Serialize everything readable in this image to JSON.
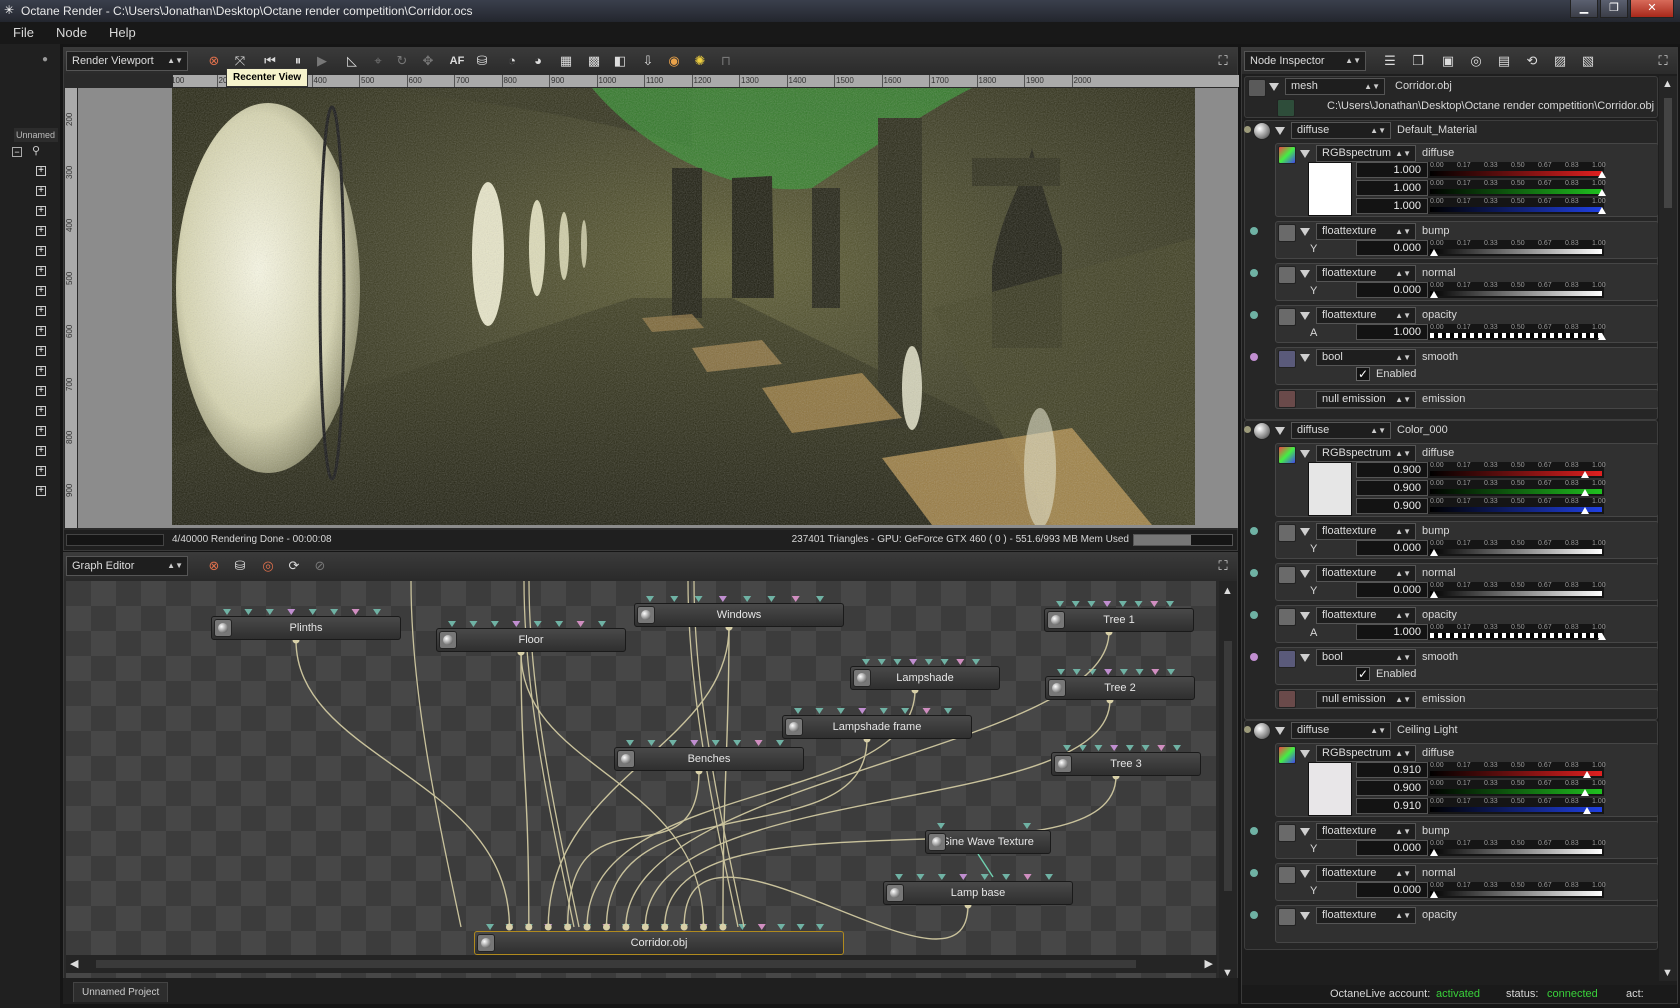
{
  "window": {
    "title": "Octane Render - C:\\Users\\Jonathan\\Desktop\\Octane render competition\\Corridor.ocs"
  },
  "menu": [
    "File",
    "Node",
    "Help"
  ],
  "left_panel": {
    "tab_label": "Unnamed Pr"
  },
  "render_viewport": {
    "panel_label": "Render Viewport",
    "tooltip": "Recenter View",
    "af_label": "AF",
    "ruler_ticks": [
      "100",
      "200",
      "300",
      "400",
      "500",
      "600",
      "700",
      "800",
      "900",
      "1000",
      "1100",
      "1200",
      "1300",
      "1400",
      "1500",
      "1600",
      "1700",
      "1800",
      "1900",
      "2000"
    ],
    "ruler_left_ticks": [
      "200",
      "300",
      "400",
      "500",
      "600",
      "700",
      "800",
      "900"
    ],
    "status_left": "4/40000 Rendering Done - 00:00:08",
    "status_right": "237401 Triangles - GPU: GeForce GTX 460 ( 0 ) - 551.6/993 MB Mem Used"
  },
  "graph_editor": {
    "panel_label": "Graph Editor",
    "nodes": [
      {
        "id": "plinths",
        "label": "Plinths"
      },
      {
        "id": "floor",
        "label": "Floor"
      },
      {
        "id": "windows",
        "label": "Windows"
      },
      {
        "id": "tree1",
        "label": "Tree 1"
      },
      {
        "id": "lampshade",
        "label": "Lampshade"
      },
      {
        "id": "tree2",
        "label": "Tree 2"
      },
      {
        "id": "lampshade_frame",
        "label": "Lampshade frame"
      },
      {
        "id": "benches",
        "label": "Benches"
      },
      {
        "id": "tree3",
        "label": "Tree 3"
      },
      {
        "id": "sine",
        "label": "Sine Wave Texture"
      },
      {
        "id": "lampbase",
        "label": "Lamp base"
      },
      {
        "id": "corridor",
        "label": "Corridor.obj"
      }
    ],
    "project_tab": "Unnamed Project"
  },
  "node_inspector": {
    "panel_label": "Node Inspector",
    "mesh": {
      "type": "mesh",
      "name": "Corridor.obj",
      "path": "C:\\Users\\Jonathan\\Desktop\\Octane render competition\\Corridor.obj"
    },
    "scale_labels": [
      "0.00",
      "0.17",
      "0.33",
      "0.50",
      "0.67",
      "0.83",
      "1.00"
    ],
    "materials": [
      {
        "type": "diffuse",
        "name": "Default_Material",
        "diffuse": {
          "type": "RGBspectrum",
          "label": "diffuse",
          "r": "1.000",
          "g": "1.000",
          "b": "1.000",
          "swatch": "#ffffff"
        },
        "bump": {
          "type": "floattexture",
          "label": "bump",
          "ch": "Y",
          "val": "0.000"
        },
        "normal": {
          "type": "floattexture",
          "label": "normal",
          "ch": "Y",
          "val": "0.000"
        },
        "opacity": {
          "type": "floattexture",
          "label": "opacity",
          "ch": "A",
          "val": "1.000"
        },
        "smooth": {
          "type": "bool",
          "label": "smooth",
          "checkbox": "Enabled",
          "checked": "✓"
        },
        "emission": {
          "type": "null emission",
          "label": "emission"
        }
      },
      {
        "type": "diffuse",
        "name": "Color_000",
        "diffuse": {
          "type": "RGBspectrum",
          "label": "diffuse",
          "r": "0.900",
          "g": "0.900",
          "b": "0.900",
          "swatch": "#e6e6e6"
        },
        "bump": {
          "type": "floattexture",
          "label": "bump",
          "ch": "Y",
          "val": "0.000"
        },
        "normal": {
          "type": "floattexture",
          "label": "normal",
          "ch": "Y",
          "val": "0.000"
        },
        "opacity": {
          "type": "floattexture",
          "label": "opacity",
          "ch": "A",
          "val": "1.000"
        },
        "smooth": {
          "type": "bool",
          "label": "smooth",
          "checkbox": "Enabled",
          "checked": "✓"
        },
        "emission": {
          "type": "null emission",
          "label": "emission"
        }
      },
      {
        "type": "diffuse",
        "name": "Ceiling Light",
        "diffuse": {
          "type": "RGBspectrum",
          "label": "diffuse",
          "r": "0.910",
          "g": "0.900",
          "b": "0.910",
          "swatch": "#e8e6e8"
        },
        "bump": {
          "type": "floattexture",
          "label": "bump",
          "ch": "Y",
          "val": "0.000"
        },
        "normal": {
          "type": "floattexture",
          "label": "normal",
          "ch": "Y",
          "val": "0.000"
        },
        "opacity": {
          "type": "floattexture",
          "label": "opacity"
        }
      }
    ],
    "status": {
      "account_label": "OctaneLive account:",
      "account_value": "activated",
      "status_label": "status:",
      "status_value": "connected",
      "act_label": "act:"
    }
  }
}
